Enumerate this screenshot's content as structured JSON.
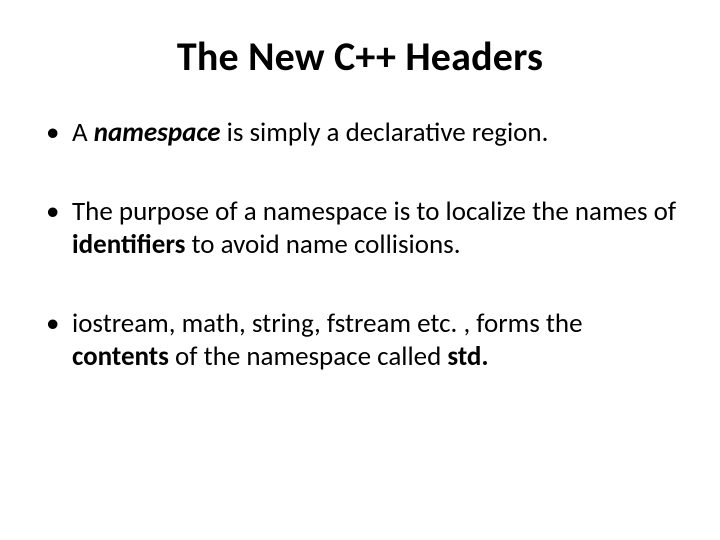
{
  "slide": {
    "title": "The New C++ Headers",
    "bullets": [
      {
        "pre": "A ",
        "em": "namespace",
        "post": " is simply a declarative region."
      },
      {
        "pre": "The purpose of a namespace is to localize the names of ",
        "em": "identifiers",
        "post": " to avoid name collisions."
      },
      {
        "pre": "iostream, math, string, fstream  etc. , forms the ",
        "em": "contents",
        "post_pre": " of the namespace called ",
        "em2": "std.",
        "post": ""
      }
    ]
  }
}
